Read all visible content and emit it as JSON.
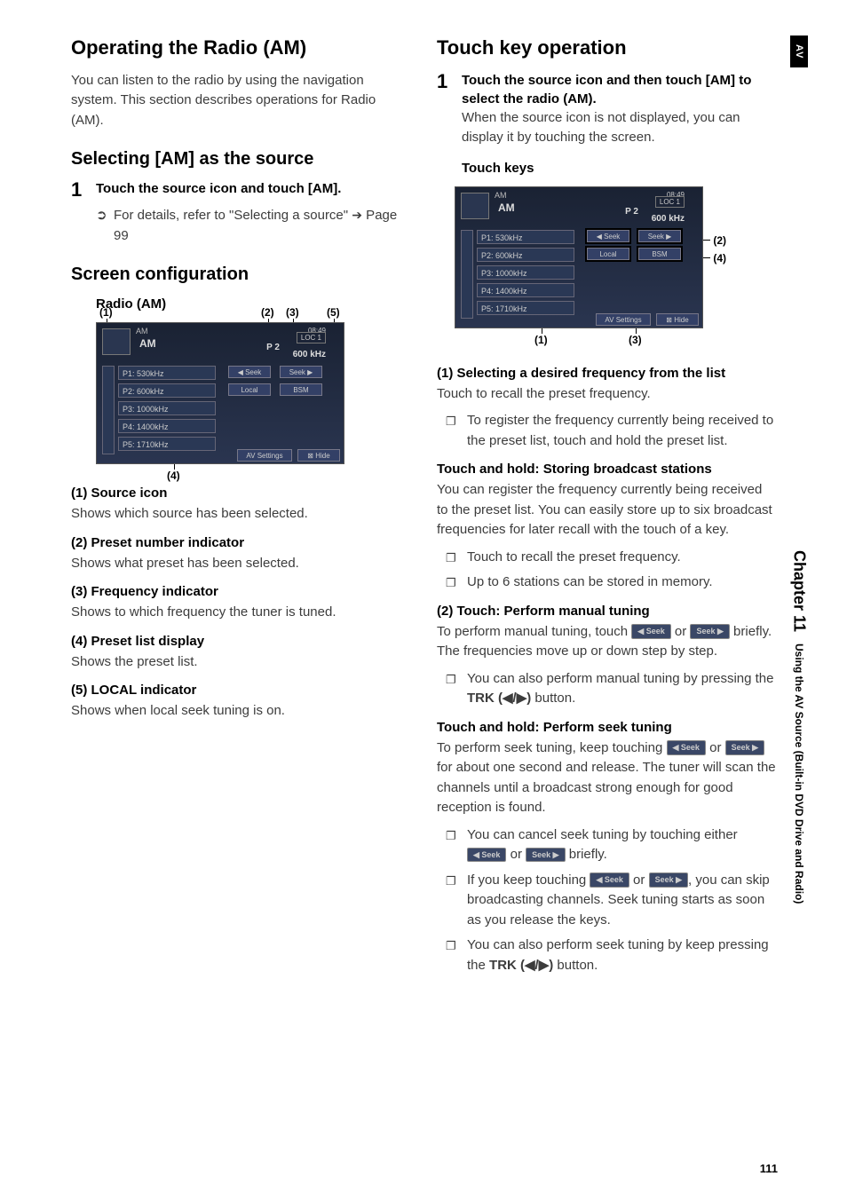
{
  "sideTab": {
    "av": "AV",
    "chapter": "Chapter 11",
    "sub": "Using the AV Source (Built-in DVD Drive and Radio)"
  },
  "pageNumber": "111",
  "left": {
    "h1": "Operating the Radio (AM)",
    "intro": "You can listen to the radio by using the navigation system. This section describes operations for Radio (AM).",
    "h2a": "Selecting [AM] as the source",
    "step1": {
      "num": "1",
      "head": "Touch the source icon and touch [AM].",
      "hint_pre": "For details, refer to \"Selecting a source\" ",
      "hint_post": " Page 99"
    },
    "h2b": "Screen configuration",
    "radioLabel": "Radio (AM)",
    "callouts": {
      "c1": "(1)",
      "c2": "(2)",
      "c3": "(3)",
      "c4": "(4)",
      "c5": "(5)"
    },
    "items": {
      "i1h": "(1) Source icon",
      "i1d": "Shows which source has been selected.",
      "i2h": "(2) Preset number indicator",
      "i2d": "Shows what preset has been selected.",
      "i3h": "(3) Frequency indicator",
      "i3d": "Shows to which frequency the tuner is tuned.",
      "i4h": "(4) Preset list display",
      "i4d": "Shows the preset list.",
      "i5h": "(5) LOCAL indicator",
      "i5d": "Shows when local seek tuning is on."
    },
    "shot": {
      "am": "AM",
      "big": "AM",
      "time": "08:49",
      "loc": "LOC 1",
      "preset": "P 2",
      "freq": "600 kHz",
      "rows": [
        "P1: 530kHz",
        "P2: 600kHz",
        "P3: 1000kHz",
        "P4: 1400kHz",
        "P5: 1710kHz"
      ],
      "seekL": "◀ Seek",
      "seekR": "Seek ▶",
      "local": "Local",
      "bsm": "BSM",
      "av": "AV Settings",
      "hide": "⊠ Hide"
    }
  },
  "right": {
    "h1": "Touch key operation",
    "step1": {
      "num": "1",
      "head": "Touch the source icon and then touch [AM] to select the radio (AM).",
      "body": "When the source icon is not displayed, you can display it by touching the screen."
    },
    "touchKeysLabel": "Touch keys",
    "callouts": {
      "c1": "(1)",
      "c2": "(2)",
      "c3": "(3)",
      "c4": "(4)"
    },
    "sec1h": "(1) Selecting a desired frequency from the list",
    "sec1d": "Touch to recall the preset frequency.",
    "note1": "To register the frequency currently being received to the preset list, touch and hold the preset list.",
    "thh": "Touch and hold: Storing broadcast stations",
    "thd": "You can register the frequency currently being received to the preset list. You can easily store up to six broadcast frequencies for later recall with the touch of a key.",
    "noteA": "Touch to recall the preset frequency.",
    "noteB": "Up to 6 stations can be stored in memory.",
    "sec2h": "(2) Touch: Perform manual tuning",
    "sec2d_pre": "To perform manual tuning, touch ",
    "sec2d_mid": " or ",
    "sec2d_post": " briefly. The frequencies move up or down step by step.",
    "noteC_pre": "You can also perform manual tuning by pressing the ",
    "trk": "TRK (◀/▶)",
    "noteC_post": " button.",
    "th2h": "Touch and hold: Perform seek tuning",
    "th2d_pre": "To perform seek tuning, keep touching ",
    "th2d_mid": " or ",
    "th2d_post": " for about one second and release. The tuner will scan the channels until a broadcast strong enough for good reception is found.",
    "noteD_pre": "You can cancel seek tuning by touching either ",
    "noteD_mid": " or ",
    "noteD_post": " briefly.",
    "noteE_pre": "If you keep touching ",
    "noteE_mid": " or ",
    "noteE_post": ", you can skip broadcasting channels. Seek tuning starts as soon as you release the keys.",
    "noteF_pre": "You can also perform seek tuning by keep pressing the ",
    "noteF_post": " button.",
    "seekL": "◀ Seek",
    "seekR": "Seek ▶"
  }
}
